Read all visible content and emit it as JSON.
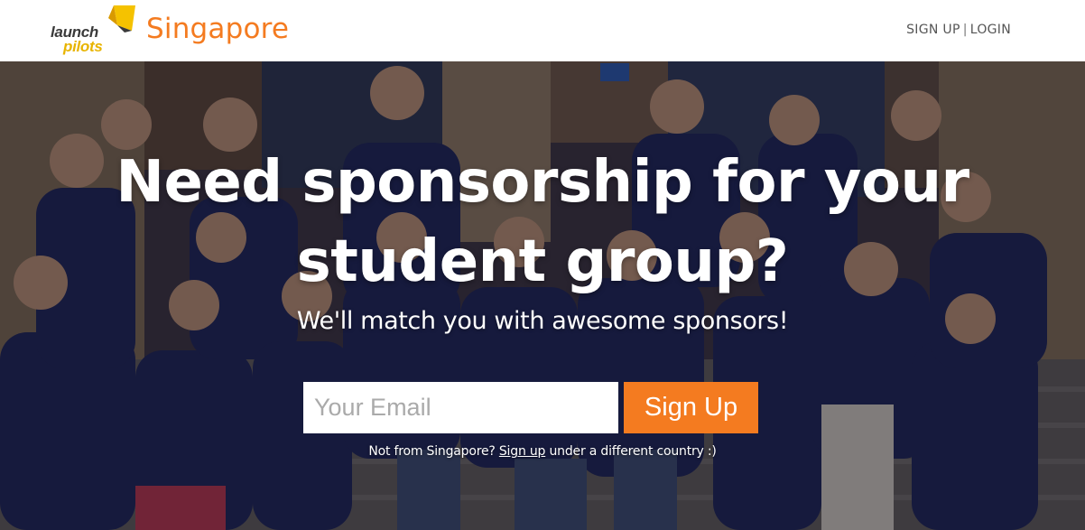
{
  "header": {
    "logo": {
      "line1": "launch",
      "line2": "pilots"
    },
    "city": "Singapore",
    "auth": {
      "signup": "SIGN UP",
      "separator": "|",
      "login": "LOGIN"
    }
  },
  "hero": {
    "headline_line1": "Need sponsorship for your",
    "headline_line2": "student group?",
    "subline": "We'll match you with awesome sponsors!",
    "email_placeholder": "Your Email",
    "signup_button": "Sign Up",
    "note_prefix": "Not from Singapore?",
    "note_link": "Sign up",
    "note_suffix": "under a different country :)"
  },
  "colors": {
    "accent": "#f47b20",
    "logo_yellow": "#e8b400",
    "logo_dark": "#3a3a3a"
  }
}
